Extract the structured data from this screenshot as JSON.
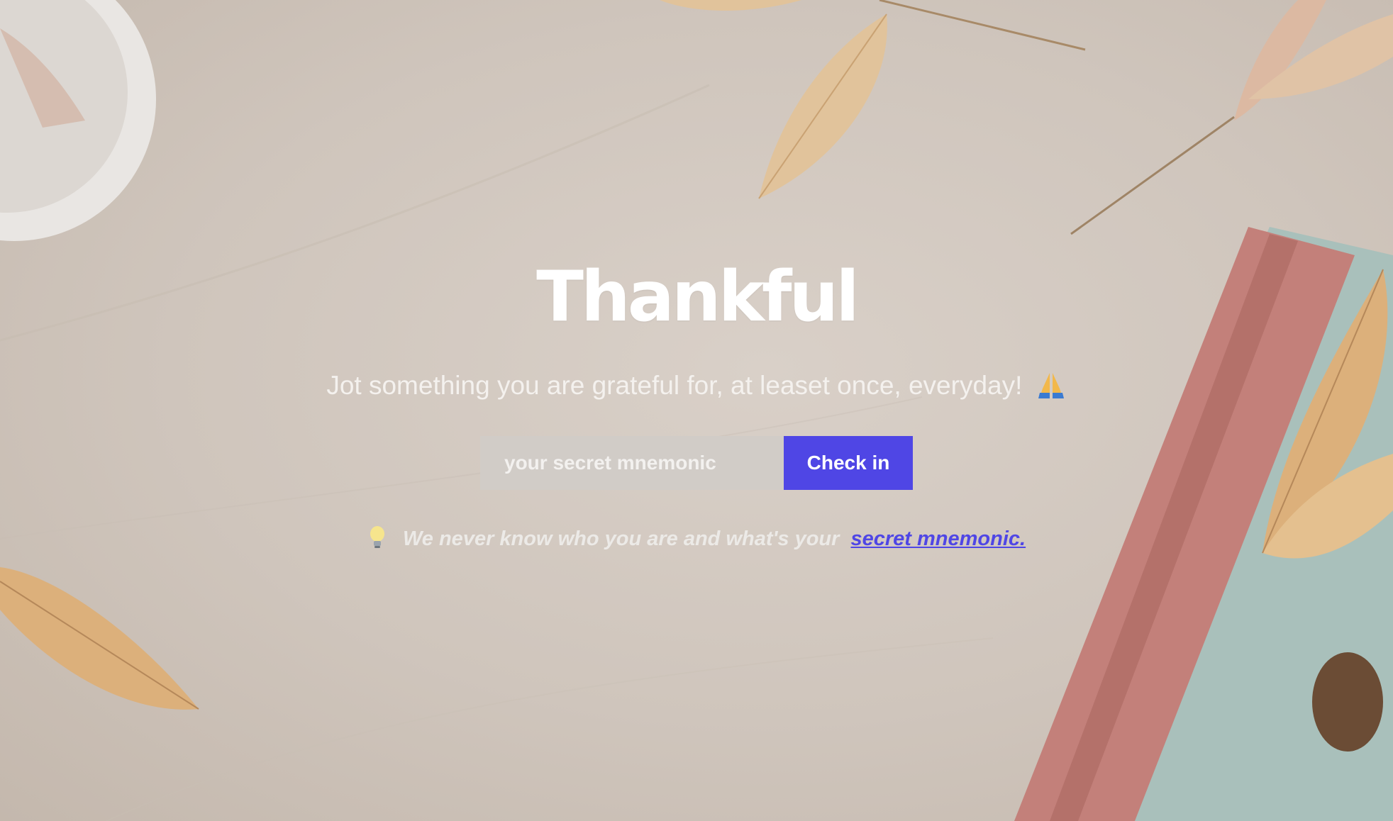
{
  "app": {
    "title": "Thankful",
    "tagline": "Jot something you are grateful for, at leaset once, everyday!",
    "tagline_emoji": "folded-hands-icon"
  },
  "checkin": {
    "input_placeholder": "your secret mnemonic",
    "input_value": "",
    "button_label": "Check in"
  },
  "note": {
    "icon": "light-bulb-icon",
    "text": "We never know who you are and what's your",
    "link_text": "secret mnemonic."
  },
  "colors": {
    "accent": "#4f46e5",
    "title": "#ffffff",
    "background": "#d6ccc3"
  }
}
